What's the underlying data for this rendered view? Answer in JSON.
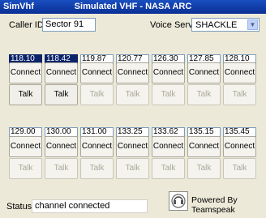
{
  "window": {
    "app_name": "SimVhf",
    "title": "Simulated VHF - NASA ARC"
  },
  "caller": {
    "label": "Caller ID:",
    "value": "Sector 91"
  },
  "voice_server": {
    "label": "Voice Server:",
    "value": "SHACKLE"
  },
  "row1": {
    "frequencies": [
      "118.10",
      "118.42",
      "119.87",
      "120.77",
      "126.30",
      "127.85",
      "128.10"
    ],
    "connect_label": "Connect",
    "talk_label": "Talk"
  },
  "row2": {
    "frequencies": [
      "129.00",
      "130.00",
      "131.00",
      "133.25",
      "133.62",
      "135.15",
      "135.45"
    ],
    "connect_label": "Connect",
    "talk_label": "Talk"
  },
  "status": {
    "label": "Status:",
    "value": "channel connected"
  },
  "powered_by": "Powered By Teamspeak",
  "icons": {
    "logo": "teamspeak-logo-icon",
    "dropdown": "chevron-down-icon"
  }
}
